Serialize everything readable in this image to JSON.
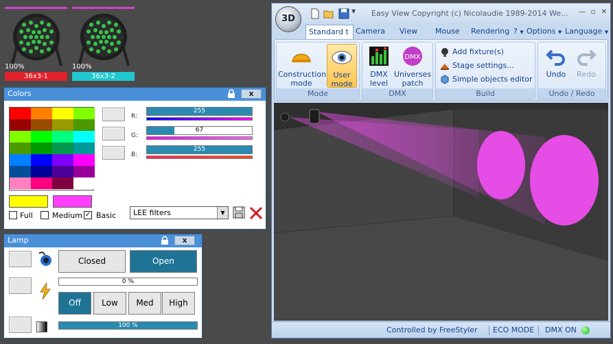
{
  "fixtures": [
    {
      "percent": "100%",
      "name": "36x3-1",
      "color": "#e0202a",
      "topbar": "#cc44cc"
    },
    {
      "percent": "100%",
      "name": "36x3-2",
      "color": "#22c8cf",
      "topbar": "#cc44cc"
    }
  ],
  "colors_window": {
    "title": "Colors",
    "close_label": "x",
    "palette": [
      [
        "#ff0000",
        "#ff8000",
        "#ffff00",
        "#80ff00"
      ],
      [
        "#990000",
        "#994d00",
        "#999900",
        "#4d9900"
      ],
      [
        "#80ff00",
        "#00ff00",
        "#00ff80",
        "#00ffff"
      ],
      [
        "#4d9900",
        "#009900",
        "#00994d",
        "#009999"
      ],
      [
        "#0080ff",
        "#0000ff",
        "#8000ff",
        "#ff00ff"
      ],
      [
        "#004d99",
        "#000099",
        "#4d0099",
        "#990099"
      ],
      [
        "#ff80c0",
        "#ff0080",
        "#800040",
        "#ffffff"
      ]
    ],
    "current_colors": [
      "#ffff00",
      "#ff40ff"
    ],
    "channels": [
      {
        "label": "R:",
        "value": "255",
        "level": 1.0,
        "gradient": "#ff00ff"
      },
      {
        "label": "G:",
        "value": "67",
        "level": 0.26,
        "gradient": "#ff00ff"
      },
      {
        "label": "B:",
        "value": "255",
        "level": 1.0,
        "gradient": "#ff4020"
      }
    ],
    "modes": [
      {
        "label": "Full",
        "checked": false
      },
      {
        "label": "Medium",
        "checked": false
      },
      {
        "label": "Basic",
        "checked": true
      }
    ],
    "filter_select": "LEE filters"
  },
  "lamp_window": {
    "title": "Lamp",
    "close_label": "x",
    "shutter": {
      "closed": "Closed",
      "open": "Open"
    },
    "dimmer_text": "0 %",
    "dimmer_level": 0,
    "power": {
      "off": "Off",
      "low": "Low",
      "med": "Med",
      "high": "High"
    },
    "master_text": "100 %",
    "master_level": 1.0
  },
  "main_window": {
    "logo_text": "3D",
    "title": "Easy View   Copyright (c) Nicolaudie 1989-2014   We...",
    "tabs": [
      "Standard t",
      "Camera",
      "View",
      "Mouse",
      "Rendering",
      "?",
      "Options",
      "Language"
    ],
    "groups": {
      "mode": {
        "footer": "Mode",
        "construction": [
          "Construction",
          "mode"
        ],
        "user": [
          "User",
          "mode"
        ]
      },
      "dmx": {
        "footer": "DMX",
        "level": [
          "DMX",
          "level"
        ],
        "patch": [
          "Universes",
          "patch"
        ]
      },
      "build": {
        "footer": "Build",
        "items": [
          "Add fixture(s)",
          "Stage settings...",
          "Simple objects editor"
        ]
      },
      "undo": {
        "footer": "Undo / Redo",
        "undo": "Undo",
        "redo": "Redo"
      }
    },
    "status": {
      "controlled": "Controlled by FreeStyler",
      "eco": "ECO MODE",
      "dmx": "DMX ON"
    },
    "beam_color": "#e64ce6"
  }
}
